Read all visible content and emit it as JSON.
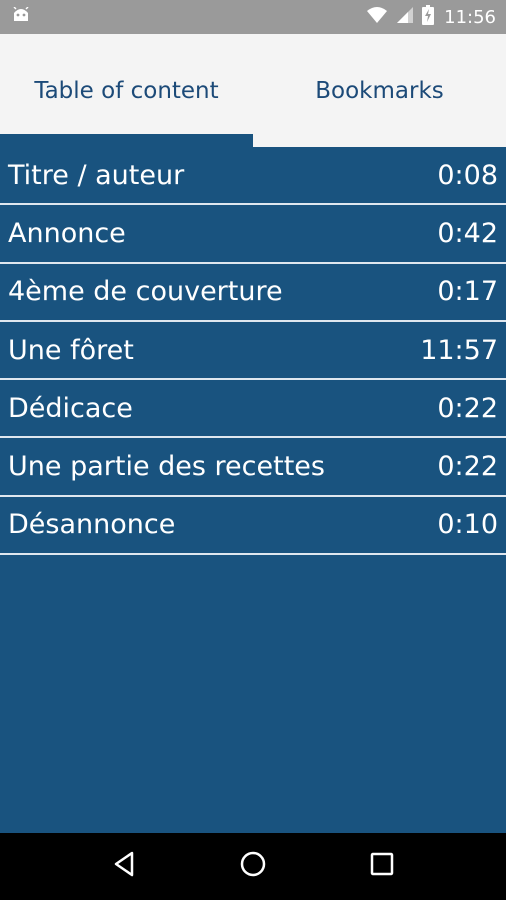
{
  "status_bar": {
    "time": "11:56",
    "icons": [
      "android-icon",
      "wifi-icon",
      "signal-icon",
      "battery-charging-icon"
    ]
  },
  "tabs": [
    {
      "label": "Table of content",
      "selected": true
    },
    {
      "label": "Bookmarks",
      "selected": false
    }
  ],
  "toc": [
    {
      "title": "Titre / auteur",
      "time": "0:08"
    },
    {
      "title": "Annonce",
      "time": "0:42"
    },
    {
      "title": "4ème de couverture",
      "time": "0:17"
    },
    {
      "title": "Une fôret",
      "time": "11:57"
    },
    {
      "title": "Dédicace",
      "time": "0:22"
    },
    {
      "title": "Une partie des recettes",
      "time": "0:22"
    },
    {
      "title": "Désannonce",
      "time": "0:10"
    }
  ],
  "nav_bar": {
    "buttons": [
      "back-icon",
      "home-icon",
      "recents-icon"
    ]
  },
  "colors": {
    "accent": "#19537f",
    "tab_text": "#1c4a78",
    "status_bar": "#9a9a9a",
    "tab_bar": "#f4f4f4"
  }
}
